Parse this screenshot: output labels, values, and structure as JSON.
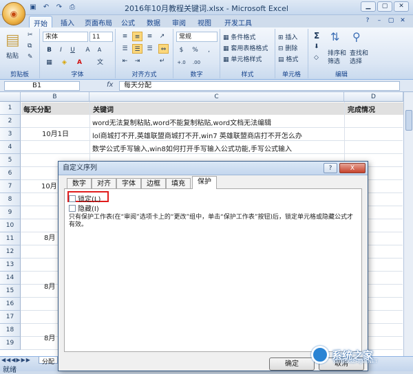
{
  "window": {
    "title": "2016年10月教程关键词.xlsx - Microsoft Excel"
  },
  "quick_access": [
    "save-icon",
    "undo-icon",
    "redo-icon",
    "print-preview-icon"
  ],
  "ribbon": {
    "tabs": [
      "开始",
      "插入",
      "页面布局",
      "公式",
      "数据",
      "审阅",
      "视图",
      "开发工具"
    ],
    "active_tab": "开始",
    "groups": {
      "clipboard": {
        "label": "剪贴板",
        "paste": "粘贴"
      },
      "font": {
        "label": "字体",
        "font_name": "宋体",
        "font_size": "11",
        "bold": "B",
        "italic": "I",
        "underline": "U",
        "grow": "A",
        "shrink": "A"
      },
      "alignment": {
        "label": "对齐方式"
      },
      "number": {
        "label": "数字",
        "format": "常规",
        "percent": "%",
        "comma": ",",
        "currency": "$"
      },
      "styles": {
        "label": "样式",
        "conditional": "条件格式",
        "table": "套用表格格式",
        "cell_styles": "单元格样式"
      },
      "cells": {
        "label": "单元格",
        "insert": "插入",
        "delete": "删除",
        "format": "格式"
      },
      "editing": {
        "label": "编辑",
        "sigma": "Σ",
        "sort": "排序和",
        "sort2": "筛选",
        "find": "查找和",
        "find2": "选择"
      }
    }
  },
  "formula_bar": {
    "cell_ref": "B1",
    "fx": "fx",
    "content": "每天分配"
  },
  "sheet": {
    "columns": [
      "B",
      "C",
      "D"
    ],
    "rows": [
      "1",
      "2",
      "3",
      "4",
      "5",
      "6",
      "7",
      "8",
      "9",
      "10",
      "11",
      "12",
      "13",
      "14",
      "15",
      "16",
      "17",
      "18",
      "19"
    ],
    "header_row": {
      "b": "每天分配",
      "c": "关键词",
      "d": "完成情况"
    },
    "b_labels": {
      "r2to4": "10月1日",
      "r7": "10月",
      "r11": "8月",
      "r16": "8月",
      "r18": "8月"
    },
    "keywords": [
      "word无法复制粘贴,word不能复制粘贴,word文档无法编辑",
      "lol商城打不开,英雄联盟商城打不开,win7 英雄联盟商店打不开怎么办",
      "数学公式手写输入,win8如何打开手写输入公式功能,手写公式输入"
    ]
  },
  "status": {
    "ready": "就绪",
    "sheet_tab": "分配"
  },
  "dialog": {
    "title": "自定义序列",
    "help": "?",
    "close": "X",
    "tabs": [
      "数字",
      "对齐",
      "字体",
      "边框",
      "填充",
      "保护"
    ],
    "active_tab": "保护",
    "locked_label": "锁定(L)",
    "hidden_label": "隐藏(I)",
    "description": "只有保护工作表(在“审阅”选项卡上的“更改”组中，单击“保护工作表”按钮)后，锁定单元格或隐藏公式才有效。",
    "ok": "确定",
    "cancel": "取消"
  },
  "watermark": {
    "text": "系统之家",
    "sub": "XITONGZHIJIA.NET"
  },
  "colors": {
    "highlight_border": "#e01b1b",
    "accent": "#15428b"
  }
}
